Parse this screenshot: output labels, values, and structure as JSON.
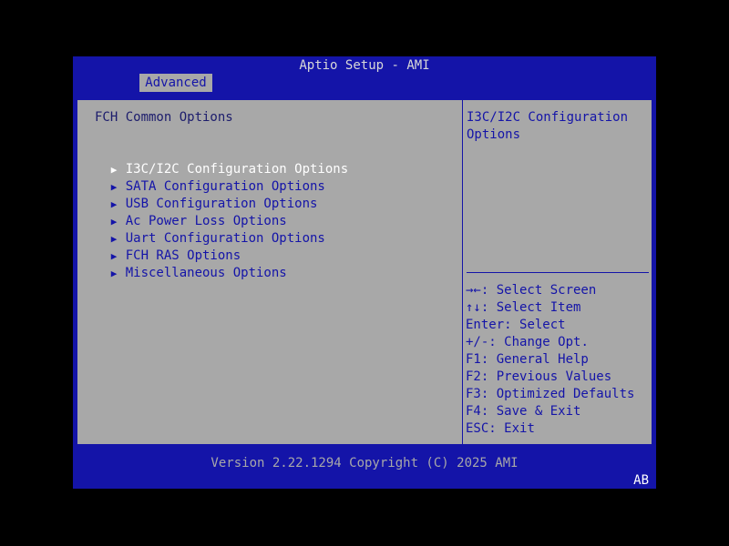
{
  "header": {
    "title": "Aptio Setup - AMI",
    "tab_label": "Advanced"
  },
  "main": {
    "section_title": "FCH Common Options",
    "arrow_glyph": "▶",
    "items": [
      {
        "label": "I3C/I2C Configuration Options",
        "selected": true
      },
      {
        "label": "SATA Configuration Options",
        "selected": false
      },
      {
        "label": "USB Configuration Options",
        "selected": false
      },
      {
        "label": "Ac Power Loss Options",
        "selected": false
      },
      {
        "label": "Uart Configuration Options",
        "selected": false
      },
      {
        "label": "FCH RAS Options",
        "selected": false
      },
      {
        "label": "Miscellaneous Options",
        "selected": false
      }
    ]
  },
  "help": {
    "text": "I3C/I2C Configuration Options",
    "keys": [
      {
        "key": "→←",
        "desc": ": Select Screen"
      },
      {
        "key": "↑↓",
        "desc": ": Select Item"
      },
      {
        "key": "Enter",
        "desc": ": Select"
      },
      {
        "key": "+/-",
        "desc": ": Change Opt."
      },
      {
        "key": "F1",
        "desc": ": General Help"
      },
      {
        "key": "F2",
        "desc": ": Previous Values"
      },
      {
        "key": "F3",
        "desc": ": Optimized Defaults"
      },
      {
        "key": "F4",
        "desc": ": Save & Exit"
      },
      {
        "key": "ESC",
        "desc": ": Exit"
      }
    ]
  },
  "footer": {
    "version": "Version 2.22.1294 Copyright (C) 2025 AMI",
    "code": "AB"
  },
  "colors": {
    "frame_blue": "#1414a8",
    "panel_gray": "#a8a8a8",
    "selected_text": "#ffffff"
  }
}
